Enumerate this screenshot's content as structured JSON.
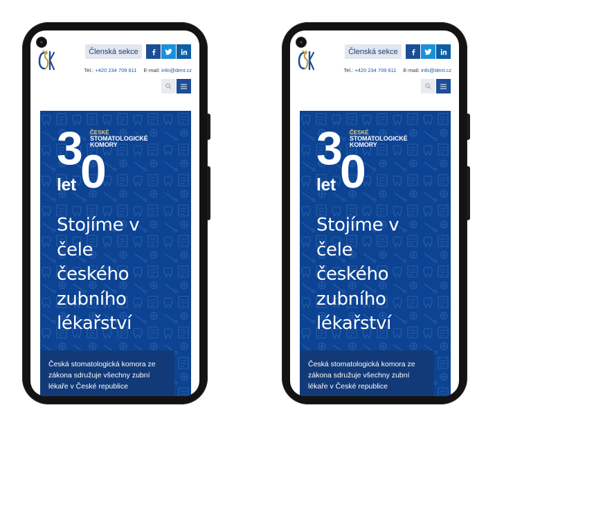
{
  "header": {
    "logo_alt": "ČSK",
    "member_section_label": "Členská sekce",
    "social": [
      {
        "name": "facebook",
        "glyph": "f"
      },
      {
        "name": "twitter",
        "glyph": "twitter-bird"
      },
      {
        "name": "linkedin",
        "glyph": "in"
      }
    ],
    "contact": {
      "phone_label": "Tel.:",
      "phone": "+420 234 709 611",
      "email_label": "E-mail:",
      "email": "info@dent.cz"
    },
    "search_icon": "search-icon",
    "menu_icon": "hamburger-icon"
  },
  "hero": {
    "badge": {
      "digit_three": "3",
      "digit_zero": "0",
      "let": "let",
      "org_line1": "ČESKÉ",
      "org_line2": "STOMATOLOGICKÉ",
      "org_line3": "KOMORY"
    },
    "headline_lines": [
      "Stojíme v",
      "čele",
      "českého",
      "zubního",
      "lékařství"
    ],
    "info_text": "Česká stomatologická komora ze zákona sdružuje všechny zubní lékaře v České republice"
  },
  "colors": {
    "brand_blue": "#0c4393",
    "info_box": "#123a78",
    "gold": "#d8c38a",
    "facebook": "#1d4d96",
    "twitter": "#1c8fd8",
    "linkedin": "#0d5fa6"
  }
}
